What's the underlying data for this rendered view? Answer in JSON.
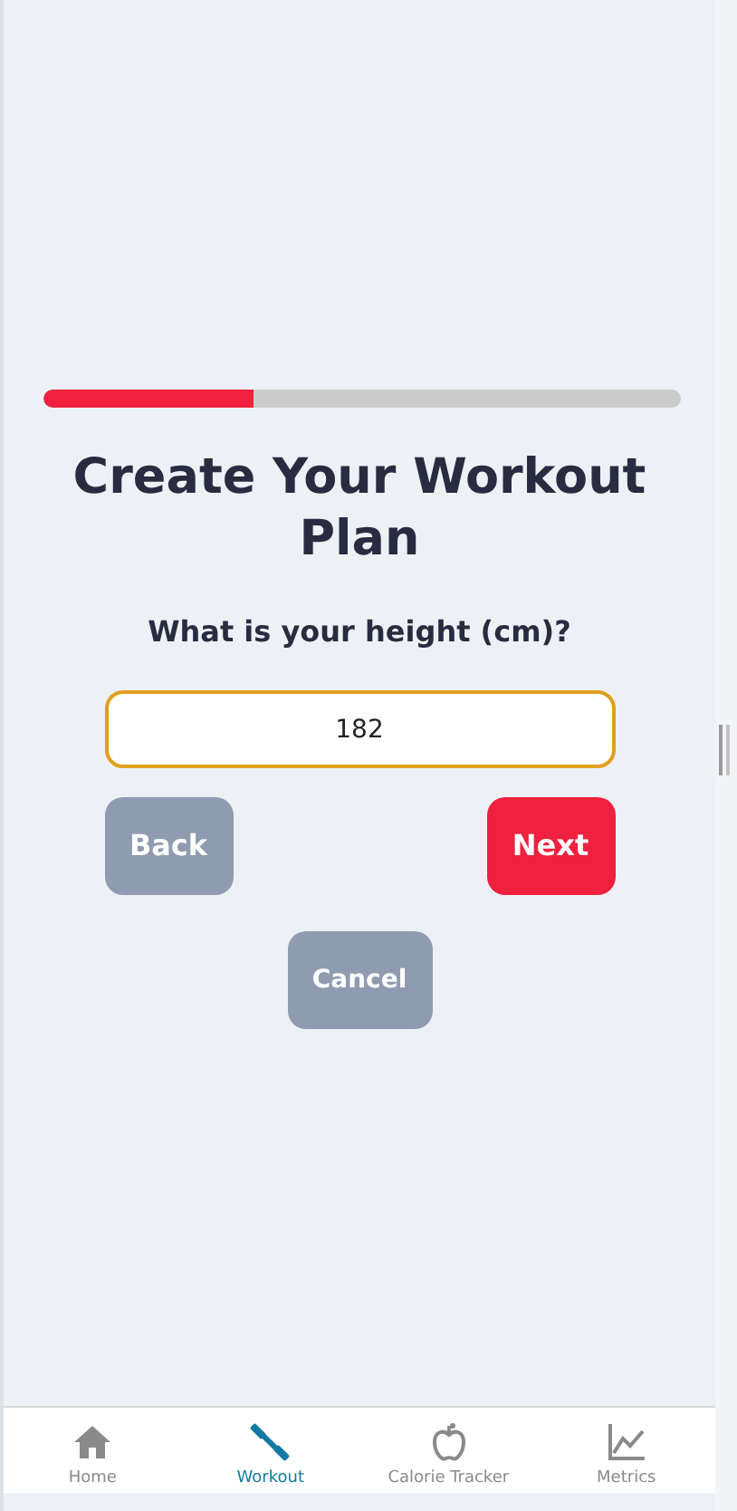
{
  "progress": {
    "level": 0.33
  },
  "title": "Create Your Workout Plan",
  "question": "What is your height (cm)?",
  "height_field": {
    "value": "182"
  },
  "buttons": [
    {
      "label": "Back",
      "kind": "secondary"
    },
    {
      "label": "Next",
      "kind": "primary"
    }
  ],
  "cancel_button": {
    "label": "Cancel"
  },
  "nav": [
    {
      "label": "Home",
      "selected": false
    },
    {
      "label": "Workout",
      "selected": true
    },
    {
      "label": "Calorie Tracker",
      "selected": false
    },
    {
      "label": "Metrics",
      "selected": false
    }
  ]
}
